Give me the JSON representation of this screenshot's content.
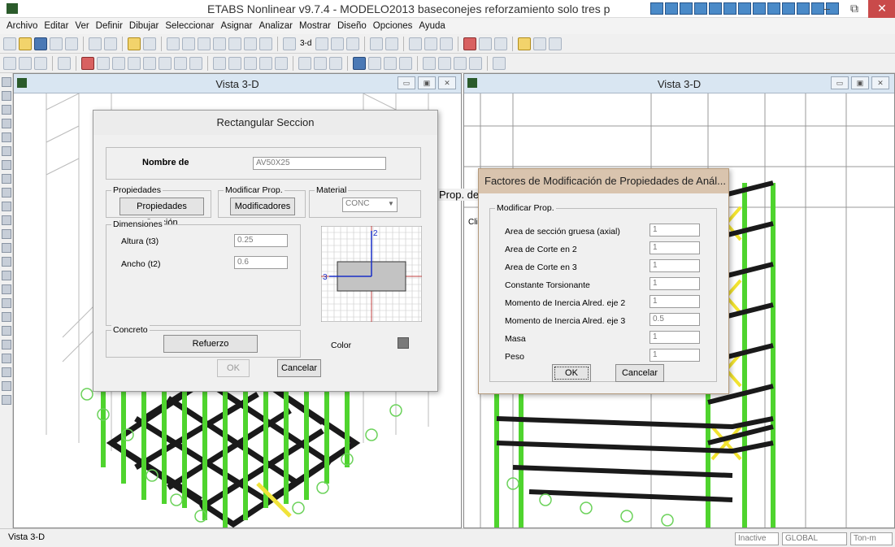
{
  "window": {
    "title": "ETABS Nonlinear v9.7.4 - MODELO2013 baseconejes reforzamiento solo tres p",
    "minimize": "–",
    "maximize": "⧉",
    "close": "✕"
  },
  "menu": [
    "Archivo",
    "Editar",
    "Ver",
    "Definir",
    "Dibujar",
    "Seleccionar",
    "Asignar",
    "Analizar",
    "Mostrar",
    "Diseño",
    "Opciones",
    "Ayuda"
  ],
  "toolbar": {
    "view_3d_label": "3-d"
  },
  "views": {
    "left_title": "Vista 3-D",
    "right_title": "Vista 3-D",
    "hidden_dialog_fragment": "Prop. del",
    "hidden_clic": "Clic"
  },
  "rect_dialog": {
    "title": "Rectangular Seccion",
    "name_label": "Nombre de",
    "name_value": "AV50X25",
    "propiedades_group": "Propiedades",
    "propiedades_button": "Propiedades Sección",
    "modificar_group": "Modificar Prop.",
    "modificadores_button": "Modificadores",
    "material_group": "Material",
    "material_value": "CONC",
    "dimensiones_group": "Dimensiones",
    "altura_label": "Altura (t3)",
    "altura_value": "0.25",
    "ancho_label": "Ancho (t2)",
    "ancho_value": "0.6",
    "concreto_group": "Concreto",
    "refuerzo_button": "Refuerzo",
    "color_label": "Color",
    "axis_2": "2",
    "axis_3": "3",
    "ok_button": "OK",
    "cancel_button": "Cancelar"
  },
  "mod_dialog": {
    "title": "Factores de Modificación de Propiedades de Anál...",
    "group": "Modificar Prop.",
    "rows": [
      {
        "label": "Area de sección gruesa (axial)",
        "value": "1"
      },
      {
        "label": "Area de Corte en 2",
        "value": "1"
      },
      {
        "label": "Area de Corte en 3",
        "value": "1"
      },
      {
        "label": "Constante Torsionante",
        "value": "1"
      },
      {
        "label": "Momento de Inercia Alred. eje 2",
        "value": "1"
      },
      {
        "label": "Momento de Inercia Alred. eje 3",
        "value": "0.5"
      },
      {
        "label": "Masa",
        "value": "1"
      },
      {
        "label": "Peso",
        "value": "1"
      }
    ],
    "ok_button": "OK",
    "cancel_button": "Cancelar"
  },
  "statusbar": {
    "left": "Vista 3-D",
    "inactive": "Inactive",
    "coord": "GLOBAL",
    "units": "Ton-m"
  }
}
